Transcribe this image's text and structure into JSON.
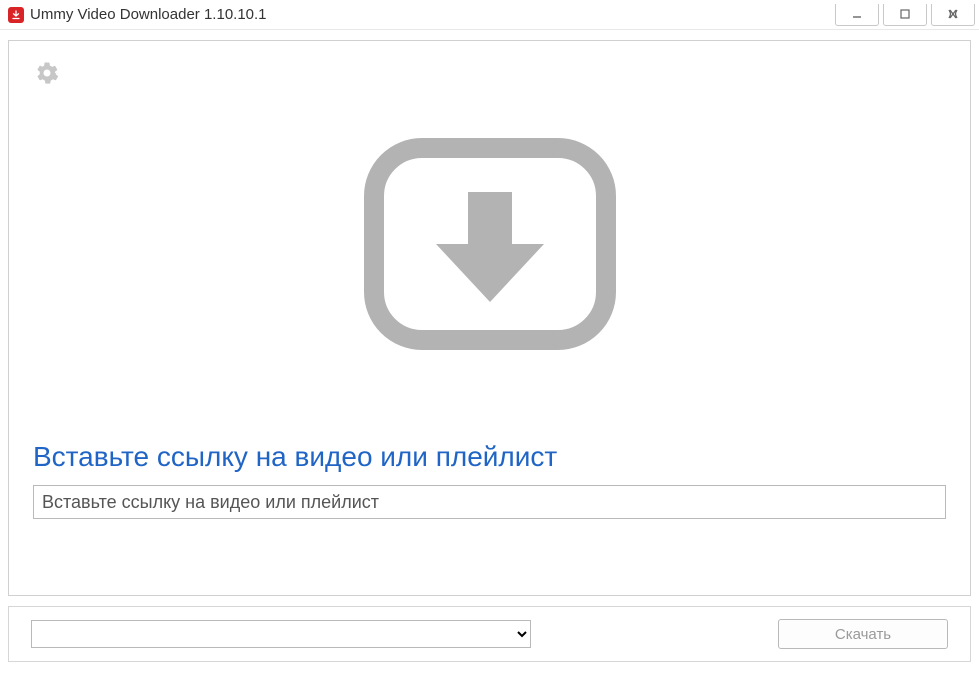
{
  "window": {
    "title": "Ummy Video Downloader 1.10.10.1"
  },
  "main": {
    "instruction": "Вставьте ссылку на видео или плейлист",
    "url_placeholder": "Вставьте ссылку на видео или плейлист",
    "url_value": ""
  },
  "bottom": {
    "format_selected": "",
    "download_label": "Скачать"
  },
  "icons": {
    "app": "download-arrow",
    "settings": "gear",
    "hero": "rounded-square-download-arrow"
  },
  "colors": {
    "accent_red": "#d92427",
    "link_blue": "#2065c5",
    "icon_gray": "#b3b3b3"
  }
}
